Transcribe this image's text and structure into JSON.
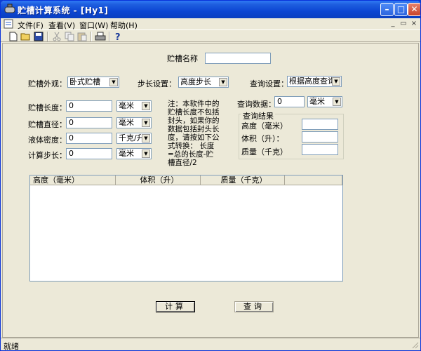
{
  "window": {
    "title": "贮槽计算系统 - [Hy1]",
    "minimize_glyph": "–",
    "maximize_glyph": "□",
    "close_glyph": "✕",
    "icon": "tank-app-icon"
  },
  "menu": {
    "items": [
      "文件(F)",
      "查看(V)",
      "窗口(W)",
      "帮助(H)"
    ],
    "mdi_controls": [
      "_",
      "▭",
      "×"
    ]
  },
  "toolbar": {
    "buttons": [
      "new-icon",
      "open-icon",
      "save-icon",
      "cut-icon",
      "copy-icon",
      "paste-icon",
      "print-icon",
      "help-icon"
    ]
  },
  "form": {
    "name_label": "贮槽名称",
    "name_value": "",
    "appearance_label": "贮槽外观：",
    "appearance_value": "卧式贮槽",
    "step_setting_label": "步长设置：",
    "step_setting_value": "高度步长",
    "query_setting_label": "查询设置：",
    "query_setting_value": "根据高度查询",
    "length_label": "贮槽长度：",
    "length_value": "0",
    "length_unit": "毫米",
    "diameter_label": "贮槽直径：",
    "diameter_value": "0",
    "diameter_unit": "毫米",
    "density_label": "液体密度：",
    "density_value": "0",
    "density_unit": "千克/升",
    "step_label": "计算步长：",
    "step_value": "0",
    "step_unit": "毫米",
    "note": "注：本软件中的贮槽长度不包括封头，如果你的数据包括封头长度，请按如下公式转换：   长度=总的长度-贮槽直径/2",
    "query_data_label": "查询数据：",
    "query_data_value": "0",
    "query_data_unit": "毫米"
  },
  "result": {
    "title": "查询结果",
    "height_label": "高度（毫米）",
    "volume_label": "体积（升）：",
    "mass_label": "质量（千克）",
    "height_value": "",
    "volume_value": "",
    "mass_value": ""
  },
  "table": {
    "columns": [
      "高度（毫米）",
      "体积（升）",
      "质量（千克）"
    ],
    "rows": []
  },
  "buttons": {
    "calculate": "计算",
    "query": "查询"
  },
  "status": {
    "text": "就绪"
  }
}
